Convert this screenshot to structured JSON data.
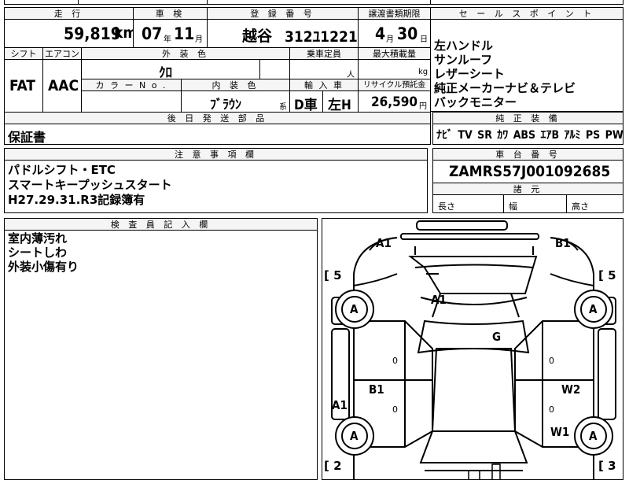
{
  "header_row": {
    "mileage_label": "走 行",
    "inspection_label": "車 検",
    "registration_label": "登 録 番 号",
    "transfer_deadline_label": "譲渡書類期限",
    "sales_points_label": "セ ー ル ス ポ イ ン ト"
  },
  "vehicle": {
    "mileage": "59,819",
    "mileage_unit": "km",
    "inspection_year": "07",
    "year_unit": "年",
    "inspection_month": "11",
    "month_unit": "月",
    "plate_area": "越谷",
    "plate_number": "312ﾕ1221",
    "deadline_month": "4",
    "deadline_month_unit": "月",
    "deadline_day": "30",
    "deadline_day_unit": "日"
  },
  "spec_labels": {
    "shift": "シフト",
    "aircon": "エアコン",
    "exterior_color": "外 装 色",
    "capacity": "乗車定員",
    "max_load": "最大積載量",
    "color_no": "カ ラ ー N o .",
    "interior_color": "内 装 色",
    "import": "輸 入 車",
    "recycle": "リサイクル預託金",
    "later_parts": "後 日 発 送 部 品",
    "notes": "注 意 事 項 欄",
    "inspector": "検 査 員 記 入 欄",
    "genuine": "純 正 装 備",
    "chassis": "車 台 番 号",
    "dimensions": "諸 元"
  },
  "specs": {
    "shift": "FAT",
    "aircon": "AAC",
    "exterior_color": "ｸﾛ",
    "capacity_unit": "人",
    "load_unit": "kg",
    "interior_color": "ﾌﾞﾗｳﾝ",
    "interior_suffix": "系",
    "import_type": "D車",
    "steering": "左H",
    "recycle_fee": "26,590",
    "recycle_unit": "円"
  },
  "sales_points": [
    "左ハンドル",
    "サンルーフ",
    "レザーシート",
    "純正メーカーナビ＆テレビ",
    "バックモニター"
  ],
  "genuine_equipment": [
    "ﾅﾋﾞ",
    "TV",
    "SR",
    "ｶﾜ",
    "ABS",
    "ｴｱB",
    "ｱﾙﾐ",
    "PS",
    "PW"
  ],
  "later_parts": "保証書",
  "notes": [
    "パドルシフト・ETC",
    "スマートキープッシュスタート",
    "H27.29.31.R3記録簿有"
  ],
  "chassis_number": "ZAMRS57J001092685",
  "dimension_labels": {
    "length": "長さ",
    "width": "幅",
    "height": "高さ"
  },
  "inspector_notes": [
    "室内薄汚れ",
    "シートしわ",
    "外装小傷有り"
  ],
  "diagram": {
    "front_left": "A1",
    "front_right": "B1",
    "hood": "A1",
    "windshield": "G",
    "left_door_front": "B1",
    "right_door_rear": "W2",
    "left_rocker": "A1",
    "right_rear_door": "W1",
    "wheel_fl": "A",
    "wheel_fr": "A",
    "wheel_rl": "A",
    "wheel_rr": "A",
    "tire_fl_label": "[ 5",
    "tire_fr_label": "[ 5",
    "tire_rl_label": "[ 2",
    "tire_rr_label": "[ 3",
    "zero_1": "0",
    "zero_2": "0",
    "zero_3": "0",
    "zero_4": "0"
  }
}
